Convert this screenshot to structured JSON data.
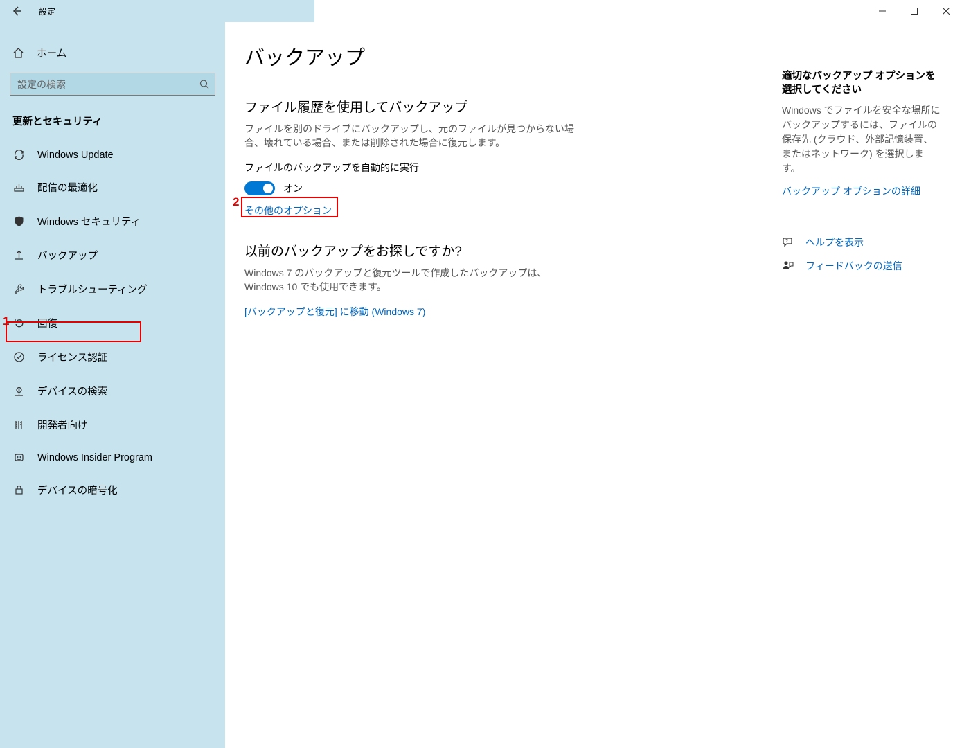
{
  "titlebar": {
    "title": "設定"
  },
  "sidebar": {
    "home": "ホーム",
    "search_placeholder": "設定の検索",
    "section": "更新とセキュリティ",
    "items": [
      {
        "label": "Windows Update"
      },
      {
        "label": "配信の最適化"
      },
      {
        "label": "Windows セキュリティ"
      },
      {
        "label": "バックアップ"
      },
      {
        "label": "トラブルシューティング"
      },
      {
        "label": "回復"
      },
      {
        "label": "ライセンス認証"
      },
      {
        "label": "デバイスの検索"
      },
      {
        "label": "開発者向け"
      },
      {
        "label": "Windows Insider Program"
      },
      {
        "label": "デバイスの暗号化"
      }
    ]
  },
  "main": {
    "page_title": "バックアップ",
    "sec1_heading": "ファイル履歴を使用してバックアップ",
    "sec1_desc": "ファイルを別のドライブにバックアップし、元のファイルが見つからない場合、壊れている場合、または削除された場合に復元します。",
    "auto_backup_label": "ファイルのバックアップを自動的に実行",
    "toggle_state": "オン",
    "more_options": "その他のオプション",
    "sec2_heading": "以前のバックアップをお探しですか?",
    "sec2_desc": "Windows 7 のバックアップと復元ツールで作成したバックアップは、Windows 10 でも使用できます。",
    "goto_backup_restore": "[バックアップと復元] に移動 (Windows 7)"
  },
  "aside": {
    "heading": "適切なバックアップ オプションを選択してください",
    "desc": "Windows でファイルを安全な場所にバックアップするには、ファイルの保存先 (クラウド、外部記憶装置、またはネットワーク) を選択します。",
    "details_link": "バックアップ オプションの詳細",
    "help": "ヘルプを表示",
    "feedback": "フィードバックの送信"
  },
  "annotations": {
    "one": "1",
    "two": "2"
  }
}
